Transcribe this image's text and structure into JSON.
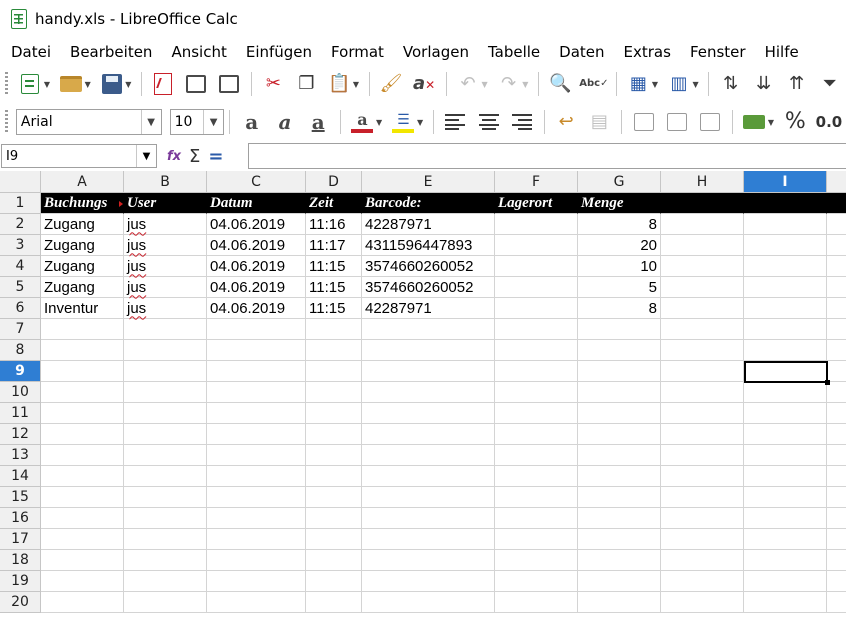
{
  "window": {
    "title": "handy.xls - LibreOffice Calc"
  },
  "menu": [
    "Datei",
    "Bearbeiten",
    "Ansicht",
    "Einfügen",
    "Format",
    "Vorlagen",
    "Tabelle",
    "Daten",
    "Extras",
    "Fenster",
    "Hilfe"
  ],
  "format_toolbar": {
    "font_name": "Arial",
    "font_size": "10",
    "percent": "%",
    "decimal": "0.0"
  },
  "formula_bar": {
    "cell_reference": "I9",
    "content": ""
  },
  "columns": [
    "A",
    "B",
    "C",
    "D",
    "E",
    "F",
    "G",
    "H",
    "I"
  ],
  "selected_column": "I",
  "rows": [
    "1",
    "2",
    "3",
    "4",
    "5",
    "6",
    "7",
    "8",
    "9",
    "10",
    "11",
    "12",
    "13",
    "14",
    "15",
    "16",
    "17",
    "18",
    "19",
    "20"
  ],
  "selected_row": "9",
  "sheet": {
    "header": [
      "Buchungs",
      "User",
      "Datum",
      "Zeit",
      "Barcode:",
      "Lagerort",
      "Menge"
    ],
    "data": [
      [
        "Zugang",
        "jus",
        "04.06.2019",
        "11:16",
        "42287971",
        "",
        "8"
      ],
      [
        "Zugang",
        "jus",
        "04.06.2019",
        "11:17",
        "4311596447893",
        "",
        "20"
      ],
      [
        "Zugang",
        "jus",
        "04.06.2019",
        "11:15",
        "3574660260052",
        "",
        "10"
      ],
      [
        "Zugang",
        "jus",
        "04.06.2019",
        "11:15",
        "3574660260052",
        "",
        "5"
      ],
      [
        "Inventur",
        "jus",
        "04.06.2019",
        "11:15",
        "42287971",
        "",
        "8"
      ]
    ]
  },
  "colors": {
    "selection_header": "#2f7ed3",
    "header_row_bg": "#000000",
    "font_color_swatch": "#c8202a",
    "highlight_swatch": "#f2e600"
  }
}
